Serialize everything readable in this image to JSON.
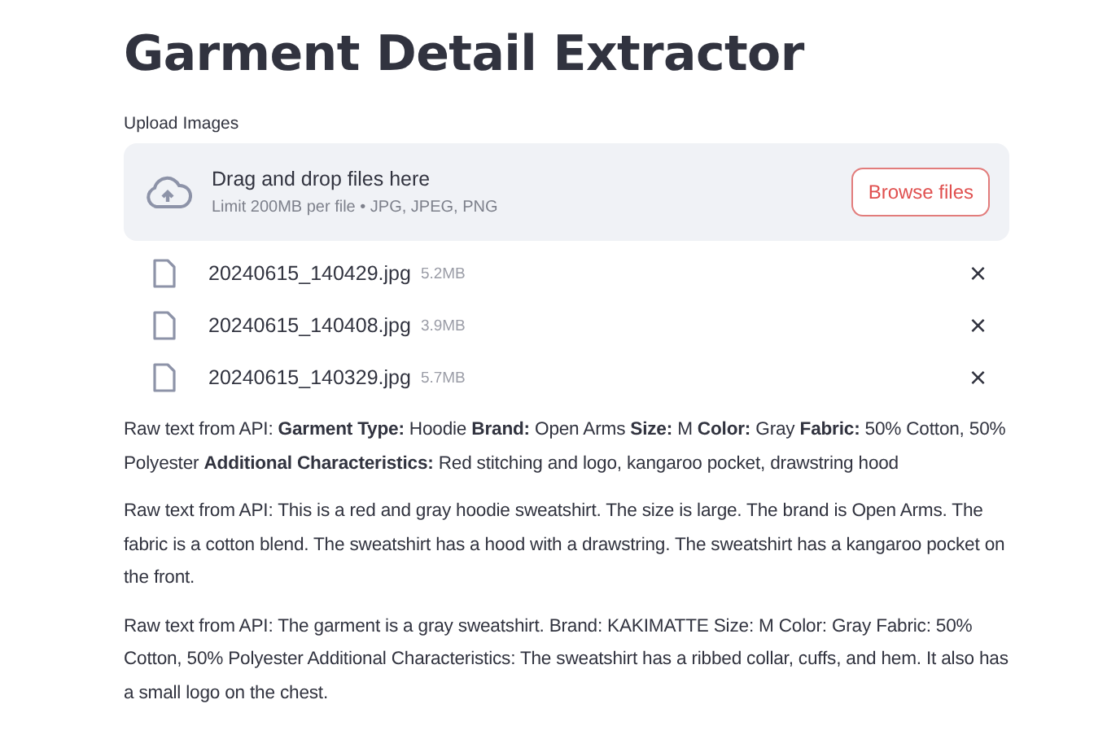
{
  "title": "Garment Detail Extractor",
  "uploader": {
    "label": "Upload Images",
    "instructions": "Drag and drop files here",
    "limits": "Limit 200MB per file • JPG, JPEG, PNG",
    "button": "Browse files"
  },
  "files": [
    {
      "name": "20240615_140429.jpg",
      "size": "5.2MB",
      "remove": "×"
    },
    {
      "name": "20240615_140408.jpg",
      "size": "3.9MB",
      "remove": "×"
    },
    {
      "name": "20240615_140329.jpg",
      "size": "5.7MB",
      "remove": "×"
    }
  ],
  "results": [
    "Raw text from API: **Garment Type:** Hoodie **Brand:** Open Arms **Size:** M **Color:** Gray **Fabric:** 50% Cotton, 50% Polyester **Additional Characteristics:** Red stitching and logo, kangaroo pocket, drawstring hood",
    "Raw text from API: This is a red and gray hoodie sweatshirt. The size is large. The brand is Open Arms. The fabric is a cotton blend. The sweatshirt has a hood with a drawstring. The sweatshirt has a kangaroo pocket on the front.",
    "Raw text from API: The garment is a gray sweatshirt. Brand: KAKIMATTE Size: M Color: Gray Fabric: 50% Cotton, 50% Polyester Additional Characteristics: The sweatshirt has a ribbed collar, cuffs, and hem. It also has a small logo on the chest."
  ]
}
